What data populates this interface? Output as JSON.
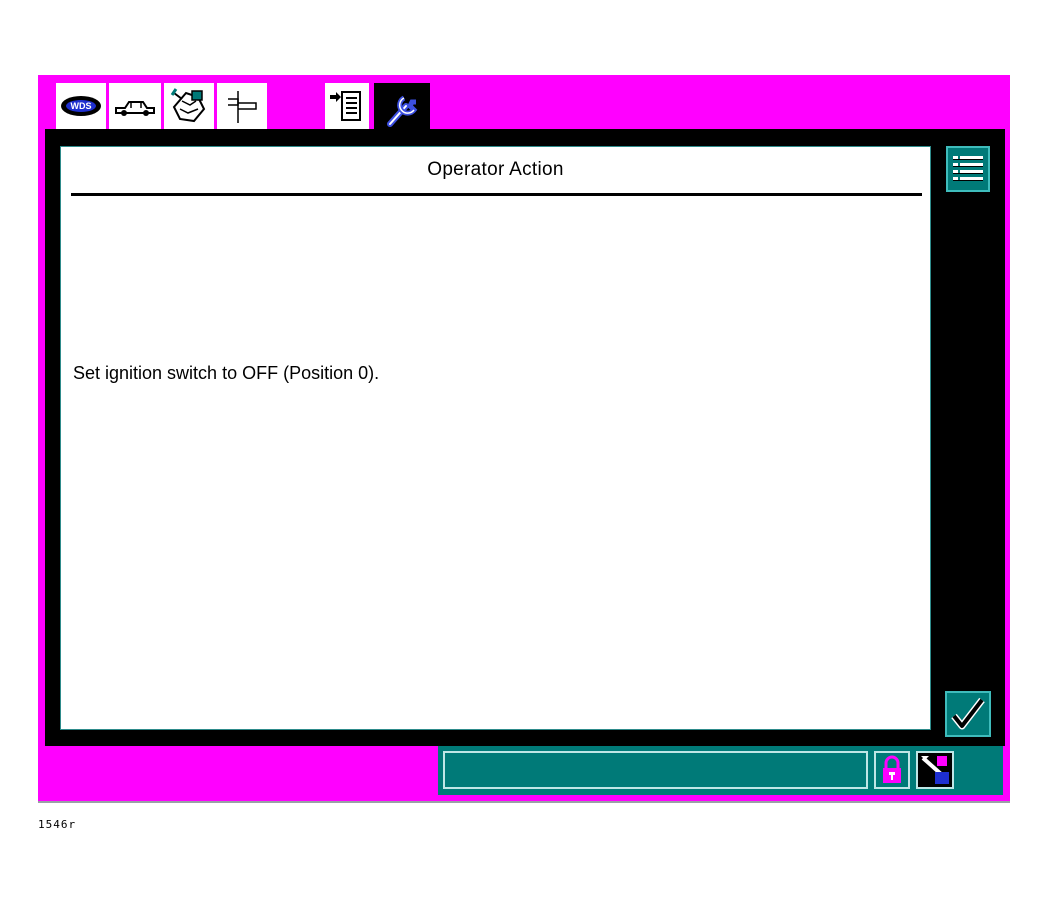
{
  "tabs": [
    {
      "icon": "wds-logo-icon",
      "active": false
    },
    {
      "icon": "vehicle-icon",
      "active": false
    },
    {
      "icon": "engine-component-icon",
      "active": false
    },
    {
      "icon": "signpost-icon",
      "active": false
    },
    {
      "icon": "document-arrow-icon",
      "active": false
    },
    {
      "icon": "wrench-icon",
      "active": true
    }
  ],
  "panel": {
    "title": "Operator Action",
    "message": "Set ignition switch to OFF (Position 0)."
  },
  "side": {
    "list_icon": "list-icon",
    "confirm_icon": "checkmark-icon"
  },
  "status": {
    "text": "",
    "lock_icon": "lock-icon",
    "connection_icon": "connection-icon"
  },
  "footer": {
    "code": "1546r"
  },
  "colors": {
    "background": "#ff00ff",
    "frame": "#000000",
    "accent": "#007a78"
  }
}
